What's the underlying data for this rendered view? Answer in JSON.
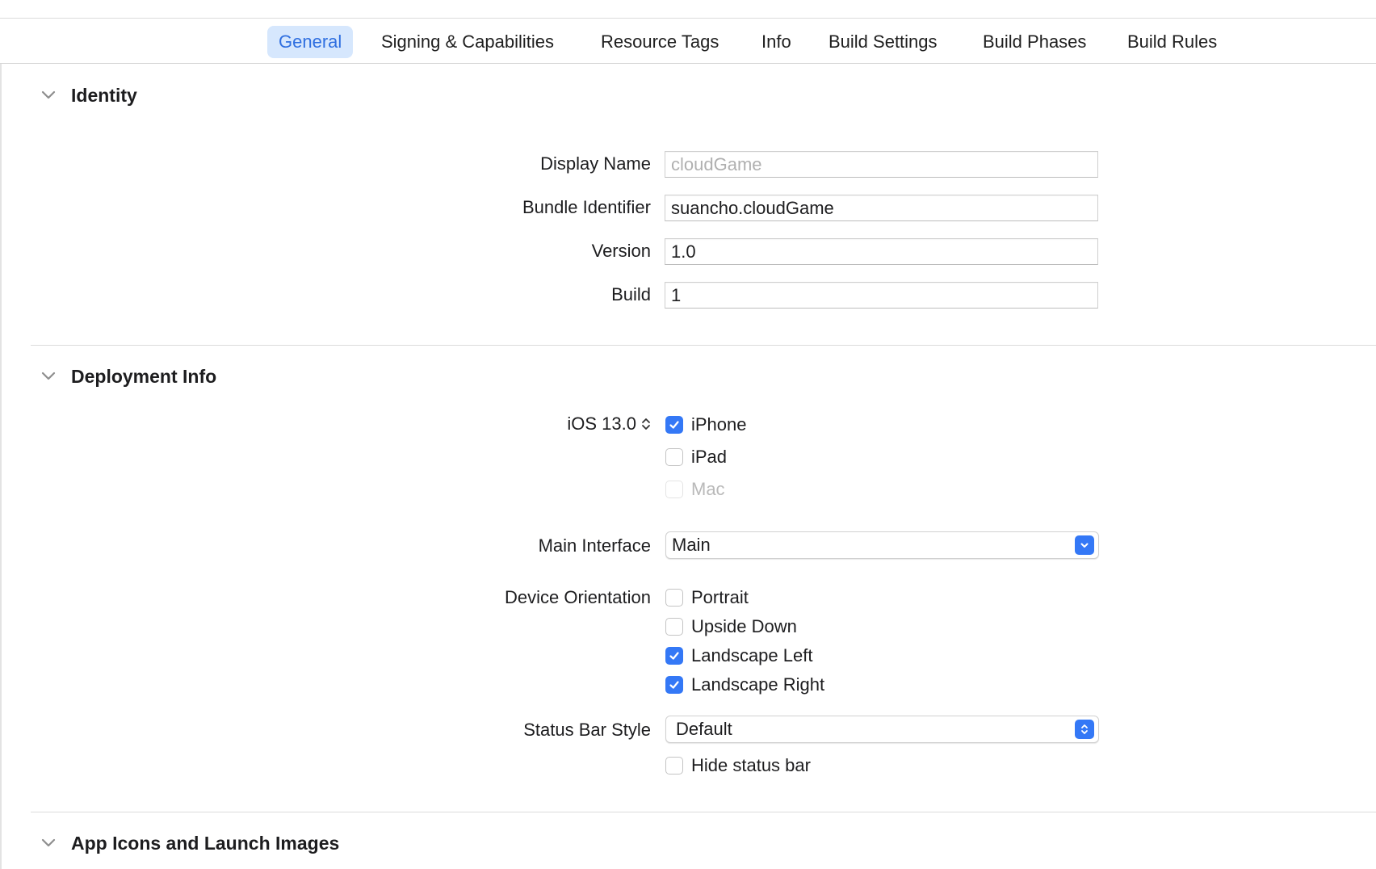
{
  "tabs": [
    {
      "label": "General",
      "active": true
    },
    {
      "label": "Signing & Capabilities"
    },
    {
      "label": "Resource Tags"
    },
    {
      "label": "Info"
    },
    {
      "label": "Build Settings"
    },
    {
      "label": "Build Phases"
    },
    {
      "label": "Build Rules"
    }
  ],
  "identity": {
    "title": "Identity",
    "display_name": {
      "label": "Display Name",
      "value": "",
      "placeholder": "cloudGame"
    },
    "bundle_identifier": {
      "label": "Bundle Identifier",
      "value": "suancho.cloudGame"
    },
    "version": {
      "label": "Version",
      "value": "1.0"
    },
    "build": {
      "label": "Build",
      "value": "1"
    }
  },
  "deployment": {
    "title": "Deployment Info",
    "ios_version": "iOS 13.0",
    "devices": [
      {
        "label": "iPhone",
        "checked": true,
        "enabled": true
      },
      {
        "label": "iPad",
        "checked": false,
        "enabled": true
      },
      {
        "label": "Mac",
        "checked": false,
        "enabled": false
      }
    ],
    "main_interface": {
      "label": "Main Interface",
      "value": "Main"
    },
    "device_orientation": {
      "label": "Device Orientation",
      "options": [
        {
          "label": "Portrait",
          "checked": false
        },
        {
          "label": "Upside Down",
          "checked": false
        },
        {
          "label": "Landscape Left",
          "checked": true
        },
        {
          "label": "Landscape Right",
          "checked": true
        }
      ]
    },
    "status_bar_style": {
      "label": "Status Bar Style",
      "value": "Default"
    },
    "hide_status_bar": {
      "label": "Hide status bar",
      "checked": false
    }
  },
  "app_icons": {
    "title": "App Icons and Launch Images"
  },
  "colors": {
    "accent": "#3478f6",
    "tab_active_bg": "#d6e7fd",
    "tab_active_text": "#2f6fe0"
  }
}
